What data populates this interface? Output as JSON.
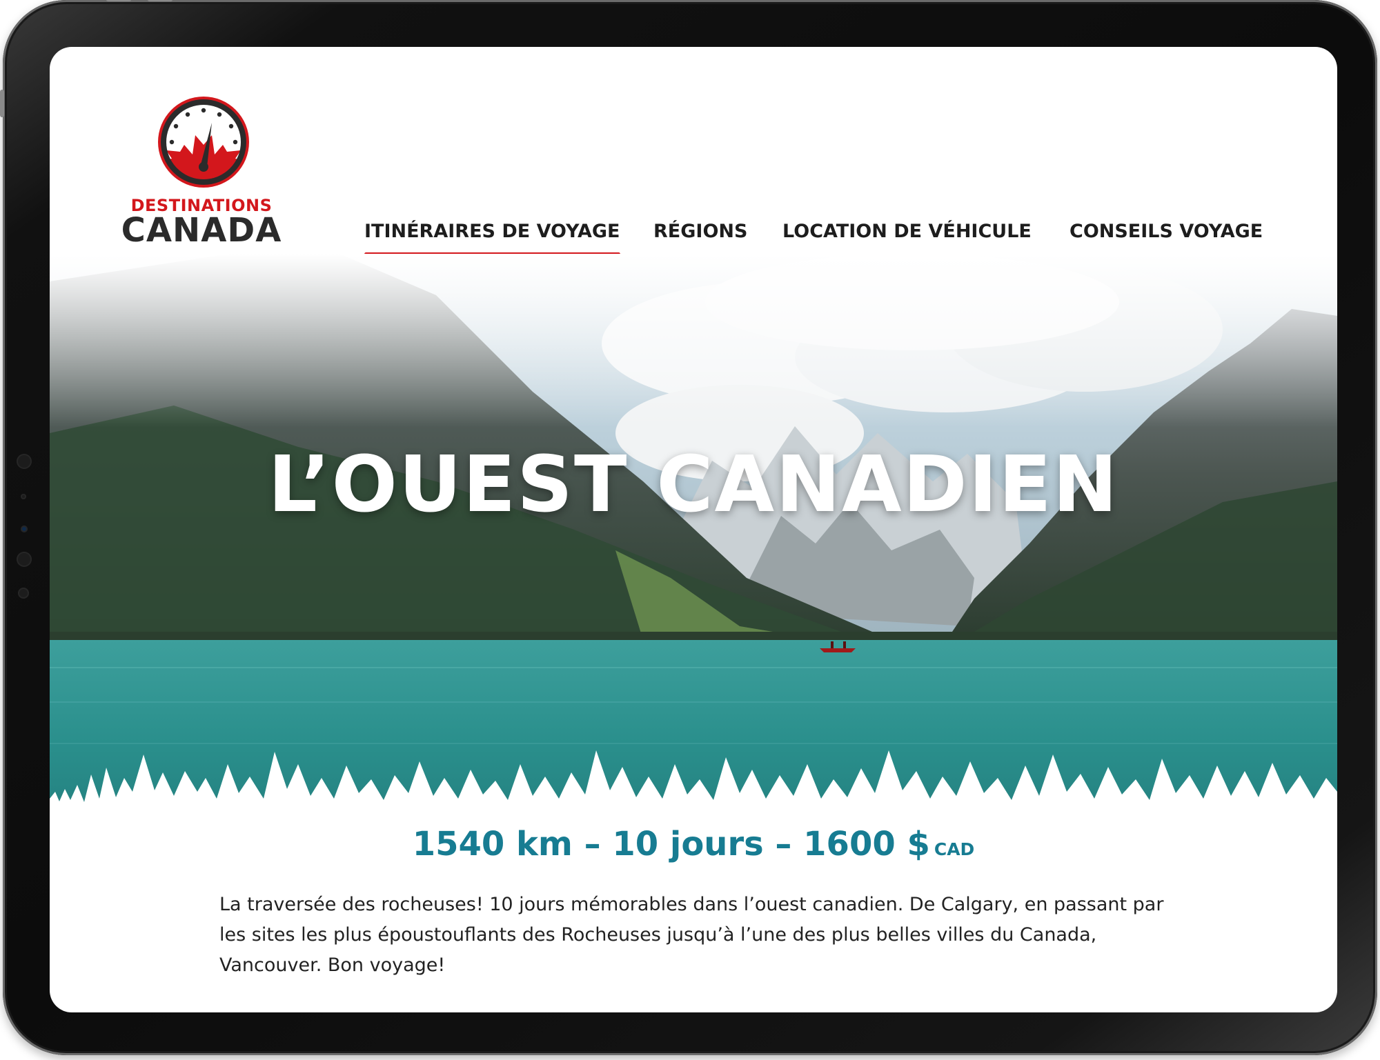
{
  "logo": {
    "line1": "DESTINATIONS",
    "line2": "CANADA"
  },
  "nav": {
    "items": [
      {
        "label": "ITINÉRAIRES DE VOYAGE",
        "active": true
      },
      {
        "label": "RÉGIONS",
        "active": false
      },
      {
        "label": "LOCATION DE VÉHICULE",
        "active": false
      },
      {
        "label": "CONSEILS VOYAGE",
        "active": false
      }
    ]
  },
  "hero": {
    "title": "L’OUEST CANADIEN"
  },
  "trip": {
    "summary": "1540 km – 10 jours – 1600 $",
    "currency": "CAD",
    "description": "La traversée des rocheuses! 10 jours mémorables dans l’ouest canadien. De Calgary, en passant par les sites les plus époustouflants des Rocheuses jusqu’à l’une des plus belles villes du Canada, Vancouver. Bon voyage!"
  },
  "colors": {
    "brand_red": "#d3171c",
    "accent_teal": "#177c92",
    "text_dark": "#1d1d1d"
  }
}
